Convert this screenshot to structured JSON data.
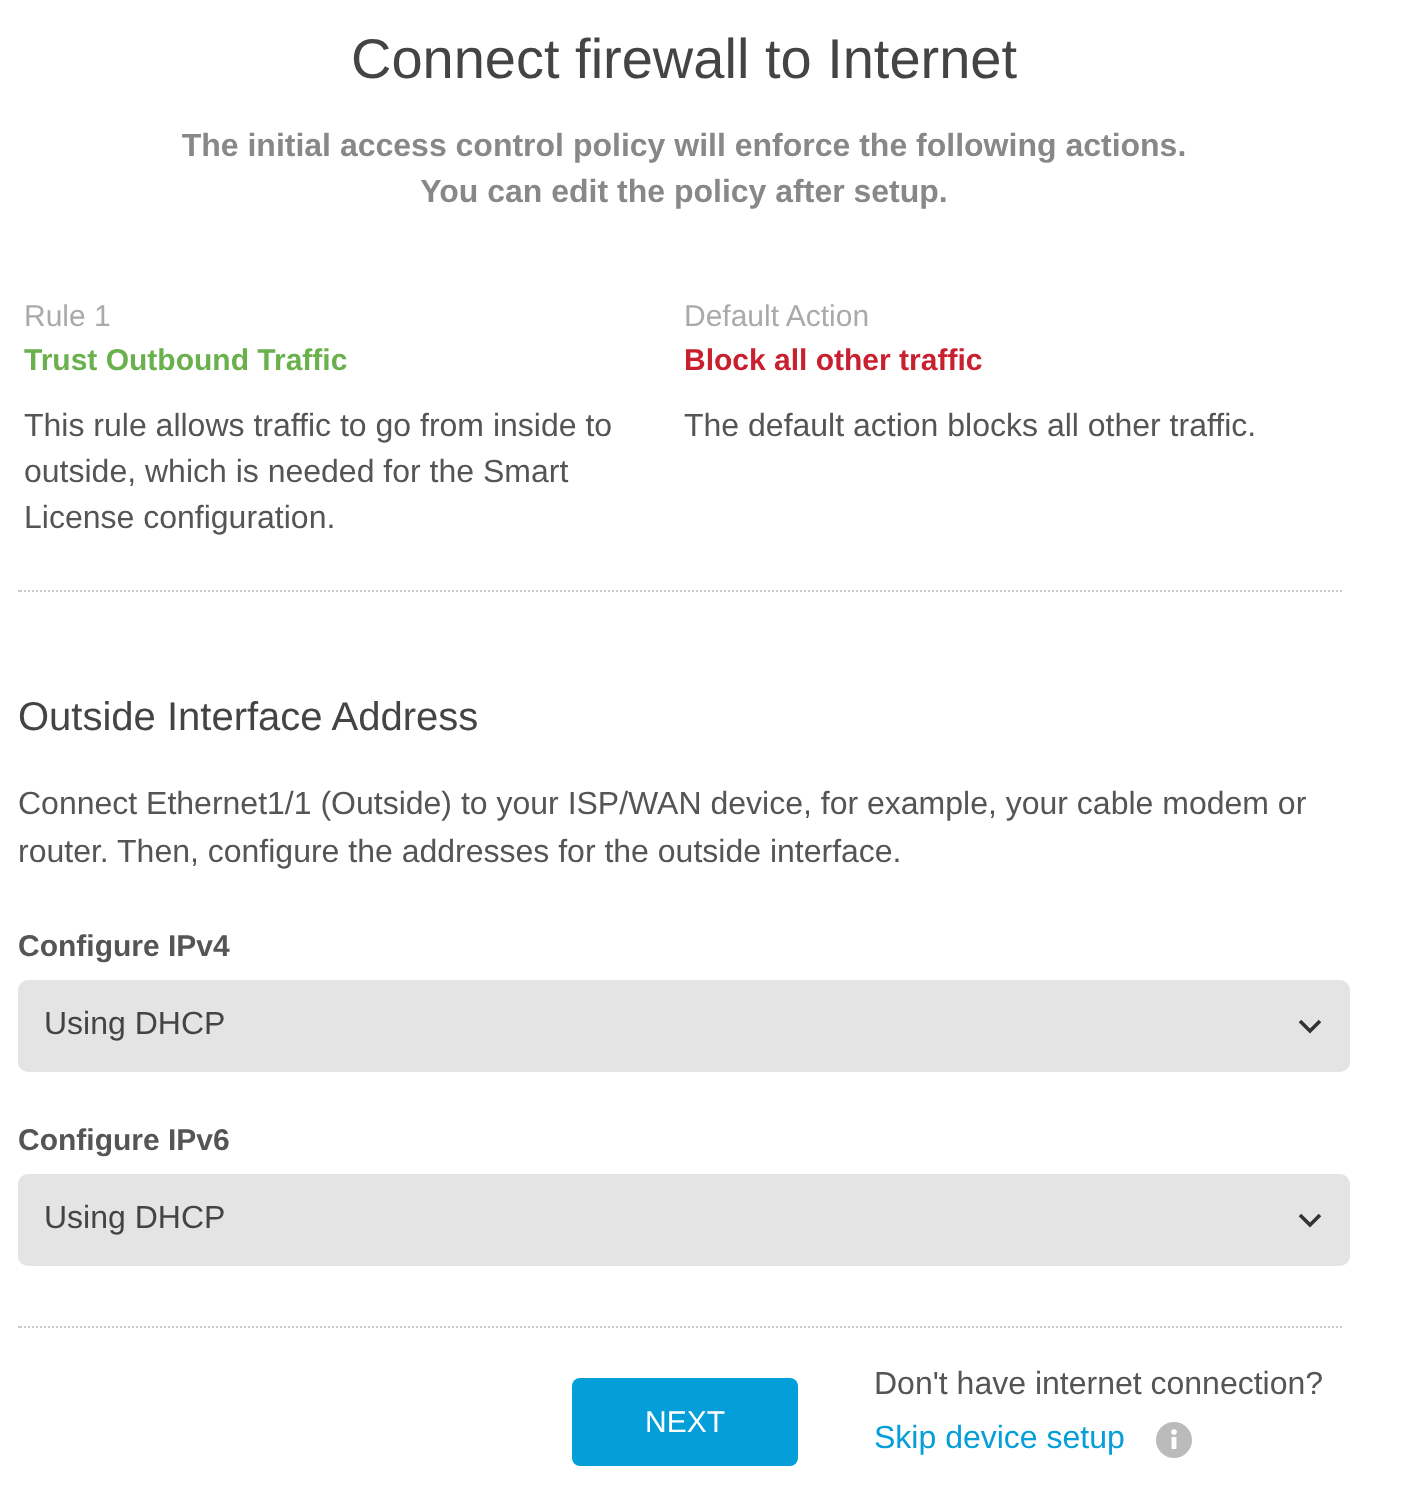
{
  "title": "Connect firewall to Internet",
  "subtitle": [
    "The initial access control policy will enforce the following actions.",
    "You can edit the policy after setup."
  ],
  "policies": [
    {
      "kind": "allow",
      "label": "Rule 1",
      "name": "Trust Outbound Traffic",
      "description": "This rule allows traffic to go from inside to outside, which is needed for the Smart License configuration."
    },
    {
      "kind": "block",
      "label": "Default Action",
      "name": "Block all other traffic",
      "description": "The default action blocks all other traffic."
    }
  ],
  "section": {
    "title": "Outside Interface Address",
    "description": "Connect Ethernet1/1 (Outside) to your ISP/WAN device, for example, your cable modem or router. Then, configure the addresses for the outside interface."
  },
  "fields": [
    {
      "label": "Configure IPv4",
      "value": "Using DHCP"
    },
    {
      "label": "Configure IPv6",
      "value": "Using DHCP"
    }
  ],
  "next_button": "NEXT",
  "help": {
    "question": "Don't have internet connection?",
    "link": "Skip device setup"
  }
}
